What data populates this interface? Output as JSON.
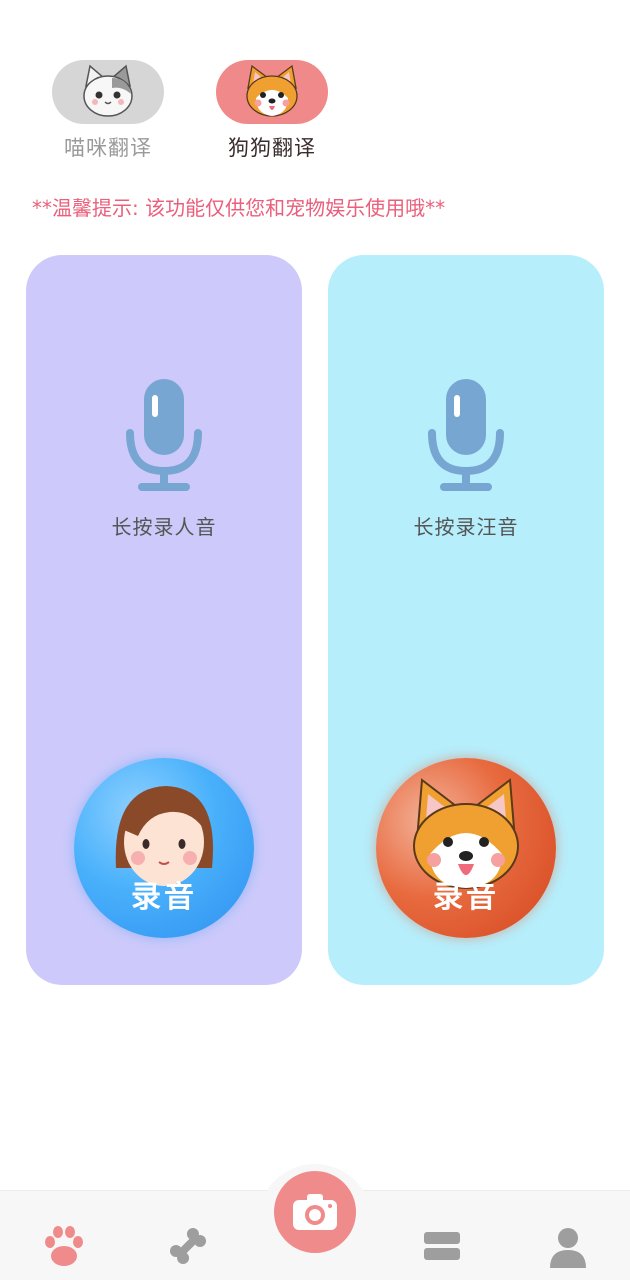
{
  "tabs": [
    {
      "label": "喵咪翻译",
      "active": false,
      "icon": "cat-face-icon"
    },
    {
      "label": "狗狗翻译",
      "active": true,
      "icon": "dog-face-icon"
    }
  ],
  "tip": "**温馨提示: 该功能仅供您和宠物娱乐使用哦**",
  "cards": {
    "human": {
      "hint": "长按录人音",
      "record_label": "录音",
      "icon": "microphone-icon",
      "avatar": "girl-avatar-icon"
    },
    "dog": {
      "hint": "长按录汪音",
      "record_label": "录音",
      "icon": "microphone-icon",
      "avatar": "shiba-dog-icon"
    }
  },
  "nav": {
    "items": [
      "paw-icon",
      "bone-icon",
      "camera-icon",
      "list-icon",
      "user-icon"
    ],
    "active": "paw-icon"
  },
  "colors": {
    "accent": "#f08a8a",
    "tip_text": "#ea5f7b",
    "human_card": "#cdcafb",
    "dog_card": "#b6eefb",
    "mic": "#78a6d2"
  }
}
